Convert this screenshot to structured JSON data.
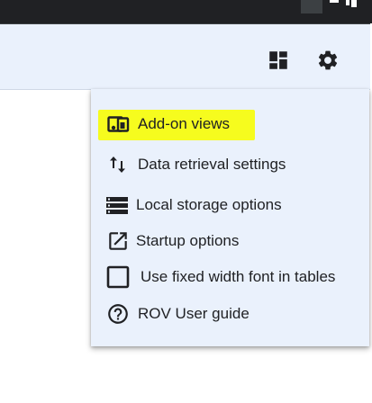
{
  "window": {
    "controls": [
      "maximize-box",
      "restore",
      "close"
    ]
  },
  "toolbar": {
    "icons": [
      "dashboard-icon",
      "settings-gear-icon"
    ]
  },
  "menu": {
    "items": [
      {
        "label": "Add-on views",
        "icon": "addon-views-icon",
        "highlighted": true
      },
      {
        "label": "Data retrieval settings",
        "icon": "swap-vertical-arrows-icon"
      },
      {
        "label": "Local storage options",
        "icon": "storage-list-icon"
      },
      {
        "label": "Startup options",
        "icon": "open-in-new-icon"
      },
      {
        "label": "Use fixed width font in tables",
        "icon": "checkbox-unchecked-icon",
        "checked": false
      },
      {
        "label": "ROV User guide",
        "icon": "help-circle-icon"
      }
    ]
  },
  "colors": {
    "titlebar": "#202124",
    "panel": "#eaf1fc",
    "highlight": "#f6fc1e",
    "icon": "#202124"
  }
}
